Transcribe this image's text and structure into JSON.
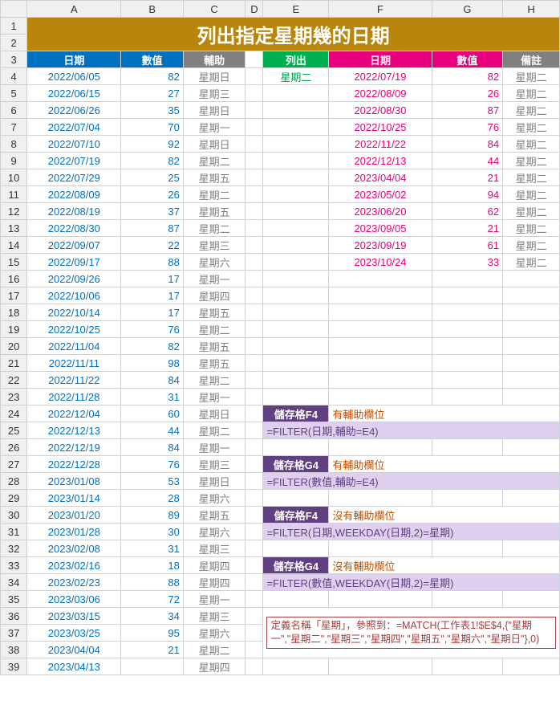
{
  "cols": [
    "",
    "A",
    "B",
    "C",
    "D",
    "E",
    "F",
    "G",
    "H"
  ],
  "title": "列出指定星期幾的日期",
  "hdr3": {
    "A": "日期",
    "B": "數值",
    "C": "輔助",
    "E": "列出",
    "F": "日期",
    "G": "數值",
    "H": "備註"
  },
  "left": [
    {
      "r": 4,
      "d": "2022/06/05",
      "v": 82,
      "w": "星期日"
    },
    {
      "r": 5,
      "d": "2022/06/15",
      "v": 27,
      "w": "星期三"
    },
    {
      "r": 6,
      "d": "2022/06/26",
      "v": 35,
      "w": "星期日"
    },
    {
      "r": 7,
      "d": "2022/07/04",
      "v": 70,
      "w": "星期一"
    },
    {
      "r": 8,
      "d": "2022/07/10",
      "v": 92,
      "w": "星期日"
    },
    {
      "r": 9,
      "d": "2022/07/19",
      "v": 82,
      "w": "星期二"
    },
    {
      "r": 10,
      "d": "2022/07/29",
      "v": 25,
      "w": "星期五"
    },
    {
      "r": 11,
      "d": "2022/08/09",
      "v": 26,
      "w": "星期二"
    },
    {
      "r": 12,
      "d": "2022/08/19",
      "v": 37,
      "w": "星期五"
    },
    {
      "r": 13,
      "d": "2022/08/30",
      "v": 87,
      "w": "星期二"
    },
    {
      "r": 14,
      "d": "2022/09/07",
      "v": 22,
      "w": "星期三"
    },
    {
      "r": 15,
      "d": "2022/09/17",
      "v": 88,
      "w": "星期六"
    },
    {
      "r": 16,
      "d": "2022/09/26",
      "v": 17,
      "w": "星期一"
    },
    {
      "r": 17,
      "d": "2022/10/06",
      "v": 17,
      "w": "星期四"
    },
    {
      "r": 18,
      "d": "2022/10/14",
      "v": 17,
      "w": "星期五"
    },
    {
      "r": 19,
      "d": "2022/10/25",
      "v": 76,
      "w": "星期二"
    },
    {
      "r": 20,
      "d": "2022/11/04",
      "v": 82,
      "w": "星期五"
    },
    {
      "r": 21,
      "d": "2022/11/11",
      "v": 98,
      "w": "星期五"
    },
    {
      "r": 22,
      "d": "2022/11/22",
      "v": 84,
      "w": "星期二"
    },
    {
      "r": 23,
      "d": "2022/11/28",
      "v": 31,
      "w": "星期一"
    },
    {
      "r": 24,
      "d": "2022/12/04",
      "v": 60,
      "w": "星期日"
    },
    {
      "r": 25,
      "d": "2022/12/13",
      "v": 44,
      "w": "星期二"
    },
    {
      "r": 26,
      "d": "2022/12/19",
      "v": 84,
      "w": "星期一"
    },
    {
      "r": 27,
      "d": "2022/12/28",
      "v": 76,
      "w": "星期三"
    },
    {
      "r": 28,
      "d": "2023/01/08",
      "v": 53,
      "w": "星期日"
    },
    {
      "r": 29,
      "d": "2023/01/14",
      "v": 28,
      "w": "星期六"
    },
    {
      "r": 30,
      "d": "2023/01/20",
      "v": 89,
      "w": "星期五"
    },
    {
      "r": 31,
      "d": "2023/01/28",
      "v": 30,
      "w": "星期六"
    },
    {
      "r": 32,
      "d": "2023/02/08",
      "v": 31,
      "w": "星期三"
    },
    {
      "r": 33,
      "d": "2023/02/16",
      "v": 18,
      "w": "星期四"
    },
    {
      "r": 34,
      "d": "2023/02/23",
      "v": 88,
      "w": "星期四"
    },
    {
      "r": 35,
      "d": "2023/03/06",
      "v": 72,
      "w": "星期一"
    },
    {
      "r": 36,
      "d": "2023/03/15",
      "v": 34,
      "w": "星期三"
    },
    {
      "r": 37,
      "d": "2023/03/25",
      "v": 95,
      "w": "星期六"
    },
    {
      "r": 38,
      "d": "2023/04/04",
      "v": 21,
      "w": "星期二"
    },
    {
      "r": 39,
      "d": "2023/04/13",
      "v": "",
      "w": "星期四"
    }
  ],
  "e4": "星期二",
  "right": [
    {
      "d": "2022/07/19",
      "v": 82,
      "h": "星期二"
    },
    {
      "d": "2022/08/09",
      "v": 26,
      "h": "星期二"
    },
    {
      "d": "2022/08/30",
      "v": 87,
      "h": "星期二"
    },
    {
      "d": "2022/10/25",
      "v": 76,
      "h": "星期二"
    },
    {
      "d": "2022/11/22",
      "v": 84,
      "h": "星期二"
    },
    {
      "d": "2022/12/13",
      "v": 44,
      "h": "星期二"
    },
    {
      "d": "2023/04/04",
      "v": 21,
      "h": "星期二"
    },
    {
      "d": "2023/05/02",
      "v": 94,
      "h": "星期二"
    },
    {
      "d": "2023/06/20",
      "v": 62,
      "h": "星期二"
    },
    {
      "d": "2023/09/05",
      "v": 21,
      "h": "星期二"
    },
    {
      "d": "2023/09/19",
      "v": 61,
      "h": "星期二"
    },
    {
      "d": "2023/10/24",
      "v": 33,
      "h": "星期二"
    }
  ],
  "blk24": {
    "cell": "儲存格F4",
    "lbl": "有輔助欄位",
    "f": "=FILTER(日期,輔助=E4)"
  },
  "blk27": {
    "cell": "儲存格G4",
    "lbl": "有輔助欄位",
    "f": "=FILTER(數值,輔助=E4)"
  },
  "blk30": {
    "cell": "儲存格F4",
    "lbl": "沒有輔助欄位",
    "f": "=FILTER(日期,WEEKDAY(日期,2)=星期)"
  },
  "blk33": {
    "cell": "儲存格G4",
    "lbl": "沒有輔助欄位",
    "f": "=FILTER(數值,WEEKDAY(日期,2)=星期)"
  },
  "note": "定義名稱「星期」，參照到：=MATCH(工作表1!$E$4,{\"星期一\",\"星期二\",\"星期三\",\"星期四\",\"星期五\",\"星期六\",\"星期日\"},0)",
  "colw": {
    "rh": 30,
    "A": 106,
    "B": 70,
    "C": 70,
    "D": 20,
    "E": 74,
    "F": 116,
    "G": 80,
    "H": 64
  }
}
